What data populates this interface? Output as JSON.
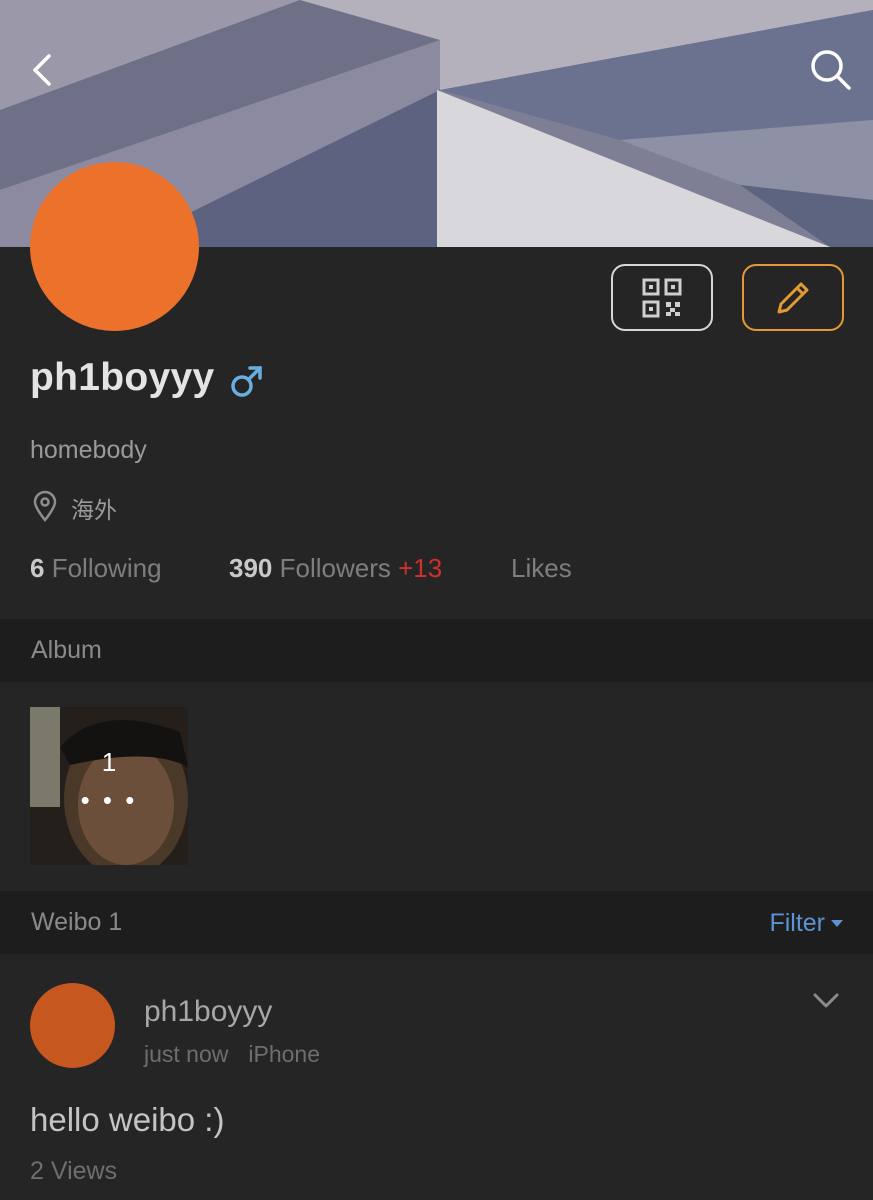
{
  "header": {
    "back_icon": "chevron-left-icon",
    "search_icon": "search-icon"
  },
  "profile": {
    "username": "ph1boyyy",
    "gender_symbol": "♂",
    "bio": "homebody",
    "location": "海外",
    "avatar_color": "#ec722b",
    "qr_icon": "qr-code-icon",
    "edit_icon": "pencil-icon"
  },
  "stats": {
    "following_count": "6",
    "following_label": "Following",
    "followers_count": "390",
    "followers_label": "Followers",
    "followers_delta": "+13",
    "likes_label": "Likes"
  },
  "album": {
    "title": "Album",
    "thumb_count": "1",
    "thumb_more": "• • •"
  },
  "weibo": {
    "title": "Weibo 1",
    "filter_label": "Filter"
  },
  "post": {
    "username": "ph1boyyy",
    "time": "just now",
    "source": "iPhone",
    "text": "hello weibo :)",
    "views": "2 Views"
  },
  "colors": {
    "accent_orange": "#e39a35",
    "link_blue": "#5b94d1",
    "delta_red": "#cf2f2f"
  }
}
